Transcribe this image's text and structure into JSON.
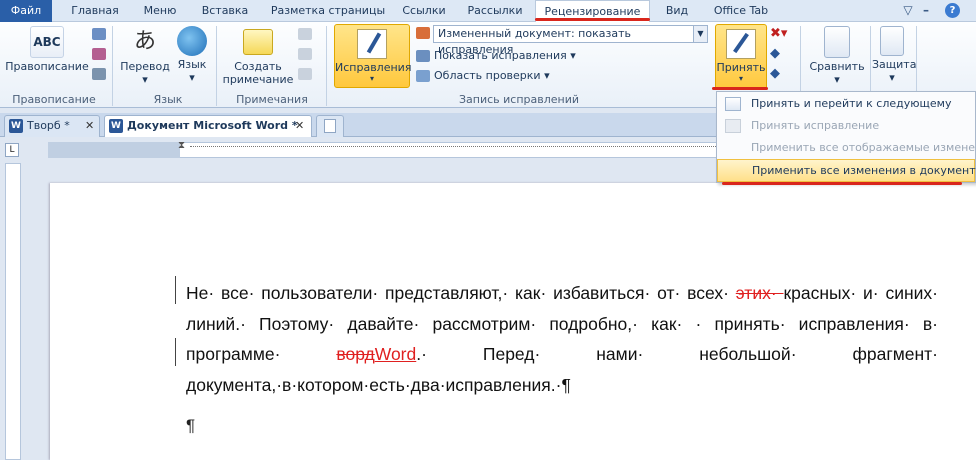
{
  "tabs": [
    "Файл",
    "Главная",
    "Меню",
    "Вставка",
    "Разметка страницы",
    "Ссылки",
    "Рассылки",
    "Рецензирование",
    "Вид",
    "Office Tab"
  ],
  "ribbon": {
    "groups": {
      "spelling": "Правописание",
      "language": "Язык",
      "comments": "Примечания",
      "tracking": "Запись исправлений"
    },
    "buttons": {
      "spelling": "Правописание",
      "translate": "Перевод",
      "language": "Язык",
      "new_comment_line1": "Создать",
      "new_comment_line2": "примечание",
      "track_changes": "Исправления",
      "accept": "Принять",
      "compare": "Сравнить",
      "protect": "Защита"
    },
    "display_combo": "Измененный документ: показать исправления",
    "show_markup": "Показать исправления",
    "review_pane": "Область проверки"
  },
  "doc_tabs": [
    {
      "label": "Творб *"
    },
    {
      "label": "Документ Microsoft Word *"
    }
  ],
  "accept_menu": {
    "item1": "Принять и перейти к следующему",
    "item2": "Принять исправление",
    "item3": "Применить все отображаемые изменени",
    "item4": "Применить все изменения в документе"
  },
  "document": {
    "p1_a": "Не· все· пользователи· представляют,· как· избавиться· от· всех· ",
    "p1_del": "этих· ",
    "p1_b": "красных· и· синих· линий.· Поэтому· давайте· рассмотрим· подробно,· как· · принять· исправления· в· программе· ",
    "p1_del2": "ворд",
    "p1_ins": "Word",
    "p1_c": ".· Перед· нами· небольшой· фрагмент· документа,·в·котором·есть·два·исправления.·¶",
    "p2": "¶"
  },
  "colors": {
    "accent_red": "#d9261c",
    "revision_red": "#e02020",
    "highlight_yellow": "#ffc83d"
  }
}
